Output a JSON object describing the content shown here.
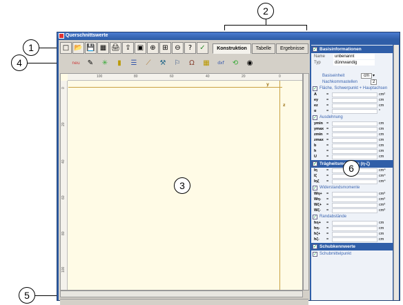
{
  "callouts": [
    "1",
    "2",
    "3",
    "4",
    "5",
    "6"
  ],
  "window": {
    "title": "Querschnittswerte"
  },
  "toolbar1": {
    "icons": [
      "new-icon",
      "open-icon",
      "save-icon",
      "grid-icon",
      "print-icon",
      "import-icon",
      "camera-icon",
      "zoom-in-icon",
      "zoom-window-icon",
      "zoom-out-icon",
      "help-icon",
      "check-icon"
    ],
    "glyphs": [
      "□",
      "📂",
      "💾",
      "▦",
      "🖨",
      "⇪",
      "▣",
      "⊕",
      "⊞",
      "⊖",
      "?",
      "✓"
    ]
  },
  "tabs": [
    "Konstruktion",
    "Tabelle",
    "Ergebnisse"
  ],
  "toolbar2": {
    "new_label": "neu",
    "glyphs": [
      "✎",
      "✳",
      "▮",
      "☰",
      "⟋",
      "⚒",
      "⚐",
      "Ω",
      "▦",
      "dxf",
      "⟲",
      "◉"
    ]
  },
  "drawing": {
    "hticks": [
      "100",
      "80",
      "60",
      "40",
      "20",
      "0"
    ],
    "vticks": [
      "0",
      "20",
      "40",
      "60",
      "80",
      "100"
    ],
    "y_label": "y",
    "z_label": "z"
  },
  "panel": {
    "basis_title": "Basisinformationen",
    "name_label": "Name",
    "name_value": "unbenannt",
    "typ_label": "Typ",
    "typ_value": "dünnwandig",
    "basiseinheit_label": "Basiseinheit",
    "basiseinheit_value": "cm",
    "nachkomma_label": "Nachkommastellen",
    "nachkomma_value": "2",
    "flaeche_title": "Fläche, Schwerpunkt + Hauptachsen",
    "flaeche_rows": [
      {
        "sym": "A",
        "unit": "cm²"
      },
      {
        "sym": "ey",
        "unit": "cm"
      },
      {
        "sym": "ez",
        "unit": "cm"
      },
      {
        "sym": "α",
        "unit": "°"
      }
    ],
    "ausdehnung_title": "Ausdehnung",
    "ausdehnung_rows": [
      {
        "sym": "ymin",
        "unit": "cm"
      },
      {
        "sym": "ymax",
        "unit": "cm"
      },
      {
        "sym": "zmin",
        "unit": "cm"
      },
      {
        "sym": "zmax",
        "unit": "cm"
      },
      {
        "sym": "b",
        "unit": "cm"
      },
      {
        "sym": "h",
        "unit": "cm"
      },
      {
        "sym": "U",
        "unit": "cm"
      }
    ],
    "traegheit_title": "Trägheitsmomente (η-ζ)",
    "traegheit_rows": [
      {
        "sym": "Iη",
        "unit": "cm⁴"
      },
      {
        "sym": "Iζ",
        "unit": "cm⁴"
      },
      {
        "sym": "Iηζ",
        "unit": "cm⁴"
      }
    ],
    "widerstand_title": "Widerstandsmomente",
    "widerstand_rows": [
      {
        "sym": "Wη+",
        "unit": "cm³"
      },
      {
        "sym": "Wη-",
        "unit": "cm³"
      },
      {
        "sym": "Wζ+",
        "unit": "cm³"
      },
      {
        "sym": "Wζ-",
        "unit": "cm³"
      }
    ],
    "rand_title": "Randabstände",
    "rand_rows": [
      {
        "sym": "hη+",
        "unit": "cm"
      },
      {
        "sym": "hη-",
        "unit": "cm"
      },
      {
        "sym": "hζ+",
        "unit": "cm"
      },
      {
        "sym": "hζ-",
        "unit": "cm"
      }
    ],
    "schub_title": "Schubkennwerte",
    "schubmittel_title": "Schubmittelpunkt"
  }
}
